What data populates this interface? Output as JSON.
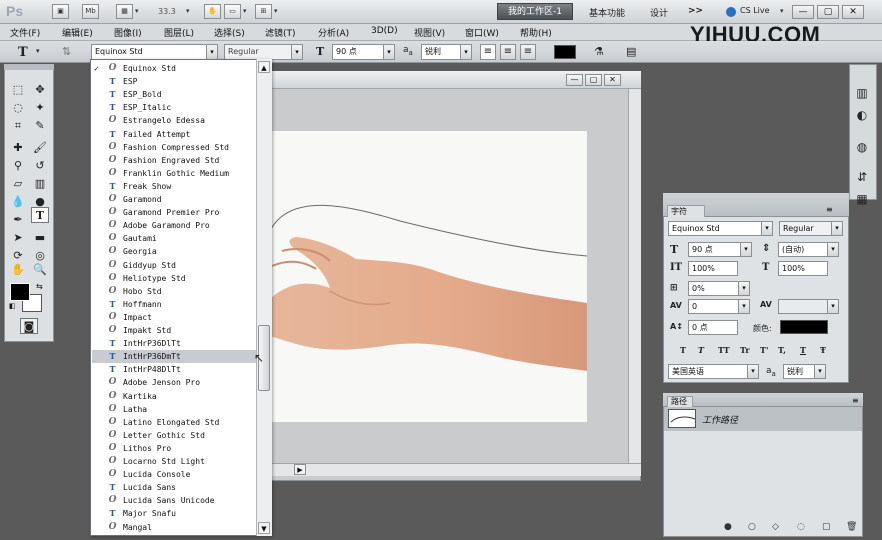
{
  "appbar": {
    "logo": "Ps",
    "icons": [
      {
        "label": "▣",
        "name": "bridge-icon"
      },
      {
        "label": "Mb",
        "name": "mini-bridge-icon"
      },
      {
        "label": "▦",
        "name": "arrange-view-icon"
      }
    ],
    "zoom": "33.3",
    "workspace_active": "我的工作区-1",
    "workspace_links": [
      "基本功能",
      "设计"
    ],
    "more": ">>",
    "cslive": "CS Live",
    "window_buttons": [
      "—",
      "▢",
      "✕"
    ]
  },
  "menu": {
    "items": [
      "文件(F)",
      "编辑(E)",
      "图像(I)",
      "图层(L)",
      "选择(S)",
      "滤镜(T)",
      "分析(A)",
      "3D(D)",
      "视图(V)",
      "窗口(W)",
      "帮助(H)"
    ]
  },
  "brand": "YIHUU.COM",
  "options": {
    "font_family": "Equinox Std",
    "font_style": "Regular",
    "font_size": "90 点",
    "aa_prefix": "a",
    "aa_suffix": "a",
    "antialias": "锐利"
  },
  "font_list": {
    "items": [
      {
        "name": "Equinox Std",
        "type": "O",
        "checked": true
      },
      {
        "name": "ESP",
        "type": "T"
      },
      {
        "name": "ESP_Bold",
        "type": "T"
      },
      {
        "name": "ESP_Italic",
        "type": "T"
      },
      {
        "name": "Estrangelo Edessa",
        "type": "O"
      },
      {
        "name": "Failed Attempt",
        "type": "T"
      },
      {
        "name": "Fashion Compressed Std",
        "type": "O"
      },
      {
        "name": "Fashion Engraved Std",
        "type": "O"
      },
      {
        "name": "Franklin Gothic Medium",
        "type": "O"
      },
      {
        "name": "Freak Show",
        "type": "T"
      },
      {
        "name": "Garamond",
        "type": "O"
      },
      {
        "name": "Garamond Premier Pro",
        "type": "O"
      },
      {
        "name": "Adobe Garamond Pro",
        "type": "O"
      },
      {
        "name": "Gautami",
        "type": "O"
      },
      {
        "name": "Georgia",
        "type": "O"
      },
      {
        "name": "Giddyup Std",
        "type": "O"
      },
      {
        "name": "Heliotype Std",
        "type": "O"
      },
      {
        "name": "Hobo Std",
        "type": "O"
      },
      {
        "name": "Hoffmann",
        "type": "T"
      },
      {
        "name": "Impact",
        "type": "O"
      },
      {
        "name": "Impakt Std",
        "type": "O"
      },
      {
        "name": "IntHrP36DlTt",
        "type": "T"
      },
      {
        "name": "IntHrP36DmTt",
        "type": "T",
        "highlight": true
      },
      {
        "name": "IntHrP48DlTt",
        "type": "T"
      },
      {
        "name": "Adobe Jenson Pro",
        "type": "O"
      },
      {
        "name": "Kartika",
        "type": "O"
      },
      {
        "name": "Latha",
        "type": "O"
      },
      {
        "name": "Latino Elongated Std",
        "type": "O"
      },
      {
        "name": "Letter Gothic Std",
        "type": "O"
      },
      {
        "name": "Lithos Pro",
        "type": "O"
      },
      {
        "name": "Locarno Std Light",
        "type": "O"
      },
      {
        "name": "Lucida Console",
        "type": "O"
      },
      {
        "name": "Lucida Sans",
        "type": "T"
      },
      {
        "name": "Lucida Sans Unicode",
        "type": "O"
      },
      {
        "name": "Major Snafu",
        "type": "T"
      },
      {
        "name": "Mangal",
        "type": "O"
      }
    ]
  },
  "character_panel": {
    "tab": "字符",
    "font_family": "Equinox Std",
    "font_style": "Regular",
    "font_size": "90 点",
    "leading": "(自动)",
    "vertical_scale": "100%",
    "horizontal_scale": "100%",
    "tracking": "0%",
    "kerning": "0",
    "baseline_shift": "0 点",
    "color_label": "颜色:",
    "style_buttons": [
      "T",
      "T",
      "TT",
      "Tr",
      "T'",
      "T,",
      "T",
      "Ŧ"
    ],
    "language": "美国英语",
    "aa_prefix": "a",
    "aa_suffix": "a",
    "antialias": "锐利"
  },
  "paths_panel": {
    "tab": "路径",
    "path_name": "工作路径",
    "footer_icons": [
      "●",
      "○",
      "◇",
      "◌",
      "▢",
      "🗑"
    ]
  },
  "colors": {
    "workspace_bg": "#5a5a5a",
    "panel_bg": "#dfe2e5",
    "highlight": "#c8ccd0",
    "truetype_icon": "#2c56a8"
  }
}
